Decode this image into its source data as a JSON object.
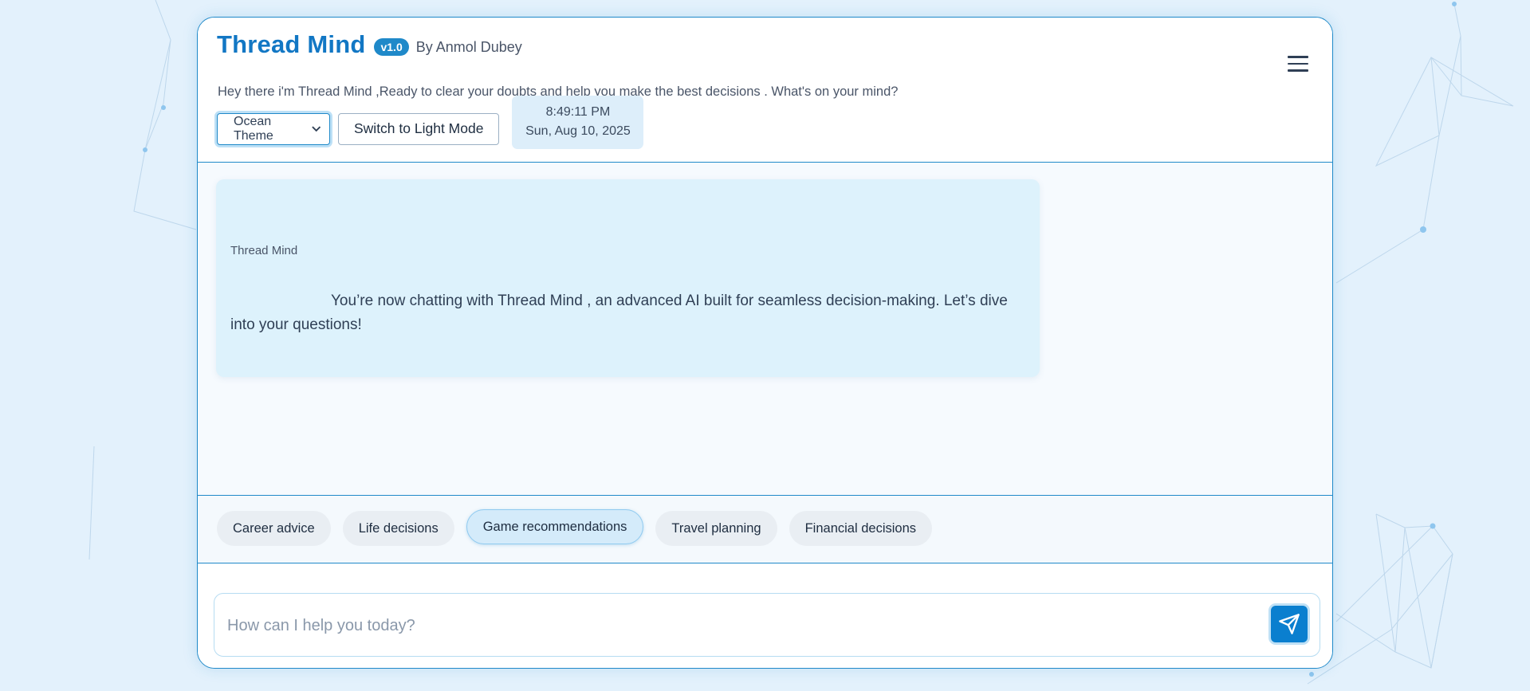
{
  "header": {
    "title": "Thread Mind",
    "version": "v1.0",
    "author": "By Anmol Dubey",
    "subtitle": "Hey there i'm Thread Mind ,Ready to clear your doubts and help you make the best decisions . What's on your mind?",
    "menu_icon": "hamburger-menu-icon"
  },
  "controls": {
    "theme_selected": "Ocean Theme",
    "mode_button": "Switch to Light Mode",
    "time": "8:49:11 PM",
    "date": "Sun, Aug 10, 2025"
  },
  "chat": {
    "messages": [
      {
        "sender": "Thread Mind",
        "text": "You’re now chatting with Thread Mind , an advanced AI built for seamless decision-making. Let’s dive into your questions!"
      }
    ]
  },
  "suggestions": {
    "chips": [
      {
        "label": "Career advice"
      },
      {
        "label": "Life decisions"
      },
      {
        "label": "Game recommendations"
      },
      {
        "label": "Travel planning"
      },
      {
        "label": "Financial decisions"
      }
    ],
    "active_index": 2
  },
  "input": {
    "placeholder": "How can I help you today?",
    "value": "",
    "send_icon": "send-paper-plane-icon"
  },
  "colors": {
    "accent": "#1f89c9",
    "title": "#1277c4",
    "background": "#e3f1fc",
    "bubble": "#ddf2fc"
  }
}
